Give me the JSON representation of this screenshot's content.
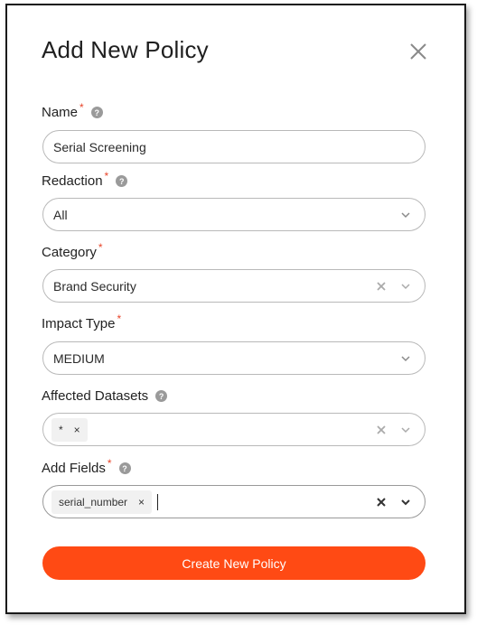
{
  "dialog": {
    "title": "Add New Policy",
    "submit_label": "Create New Policy"
  },
  "fields": {
    "name": {
      "label": "Name",
      "value": "Serial Screening"
    },
    "redaction": {
      "label": "Redaction",
      "value": "All"
    },
    "category": {
      "label": "Category",
      "value": "Brand Security"
    },
    "impact_type": {
      "label": "Impact Type",
      "value": "MEDIUM"
    },
    "affected_datasets": {
      "label": "Affected Datasets",
      "tags": [
        "*"
      ]
    },
    "add_fields": {
      "label": "Add Fields",
      "tags": [
        "serial_number"
      ]
    }
  },
  "colors": {
    "accent": "#ff4a14",
    "required": "#e8452a"
  }
}
